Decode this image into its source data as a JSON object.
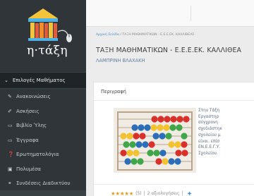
{
  "app": {
    "logo_text": "η·τάξη"
  },
  "sidebar": {
    "header_label": "Επιλογές Μαθήματος",
    "items": [
      {
        "icon": "megaphone-icon",
        "glyph": "✎",
        "label": "Ανακοινώσεις"
      },
      {
        "icon": "edit-icon",
        "glyph": "✐",
        "label": "Ασκήσεις"
      },
      {
        "icon": "book-icon",
        "glyph": "▭",
        "label": "Βιβλίο Ύλης"
      },
      {
        "icon": "folder-icon",
        "glyph": "▭",
        "label": "Έγγραφα"
      },
      {
        "icon": "question-icon",
        "glyph": "❓",
        "label": "Ερωτηματολόγια"
      },
      {
        "icon": "film-icon",
        "glyph": "▣",
        "label": "Πολυμέσα"
      },
      {
        "icon": "link-icon",
        "glyph": "⚭",
        "label": "Συνδέσεις Διαδικτύου"
      }
    ]
  },
  "breadcrumb": {
    "home": "Αρχική Σελίδα",
    "separator": "/",
    "current": "ΤΑΞΗ ΜΑΘΗΜΑΤΙΚΩΝ - Ε.Ε.Ε.ΕΚ. ΚΑΛΛΙΘΕΑΣ"
  },
  "page": {
    "title": "ΤΑΞΗ ΜΑΘΗΜΑΤΙΚΩΝ - Ε.Ε.Ε.ΕΚ. ΚΑΛΛΙΘΕΑ",
    "subtitle": "ΛΑΜΠΡΙΝΗ ΒΛΑΧΑΚΗ"
  },
  "description": {
    "title": "Περιγραφή",
    "lines": [
      "Στην Τάξη",
      "Εργαστηρ",
      "σύγχρονη",
      "σχεδιάστηκ",
      "σχολείου μ",
      "είναι. επίσ",
      "ΕΝ.Ε.Ε.Γ.Υ.",
      "Σχολείου."
    ]
  },
  "rating": {
    "stars": "★★★★★",
    "count": "(5)",
    "separator": "|",
    "reviews": "2 αξιολογήσεις",
    "plus": "✚"
  },
  "colors": {
    "sidebar_bg": "#2f3538",
    "sidebar_header_bg": "#1f2426",
    "link": "#4a8fc4",
    "star": "#e89c1e"
  }
}
